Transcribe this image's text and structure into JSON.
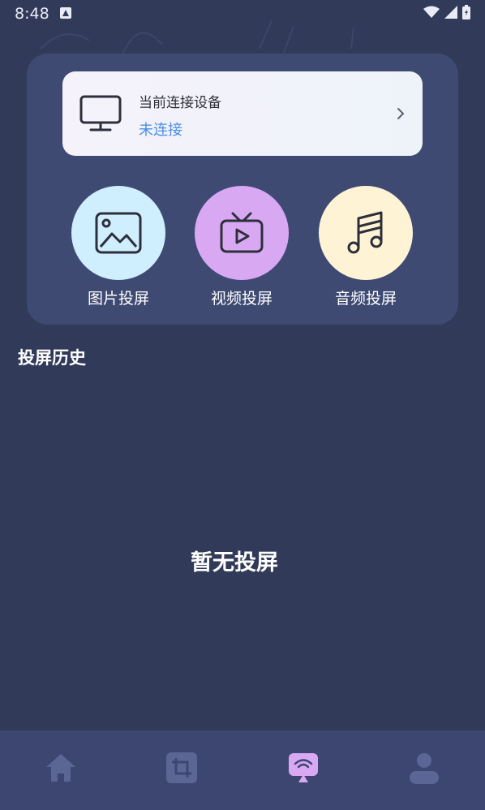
{
  "status_bar": {
    "time": "8:48"
  },
  "device": {
    "title": "当前连接设备",
    "status": "未连接"
  },
  "actions": [
    {
      "label": "图片投屏",
      "icon": "image-icon",
      "color": "#cfeefe"
    },
    {
      "label": "视频投屏",
      "icon": "tv-play-icon",
      "color": "#d9a8f3"
    },
    {
      "label": "音频投屏",
      "icon": "music-note-icon",
      "color": "#fff3d6"
    }
  ],
  "history": {
    "title": "投屏历史",
    "empty_text": "暂无投屏"
  },
  "bottom_nav": {
    "items": [
      {
        "icon": "home-icon",
        "active": false
      },
      {
        "icon": "crop-icon",
        "active": false
      },
      {
        "icon": "cast-icon",
        "active": true
      },
      {
        "icon": "profile-icon",
        "active": false
      }
    ],
    "active_color": "#d9a8f3",
    "inactive_color": "#5b6694"
  }
}
